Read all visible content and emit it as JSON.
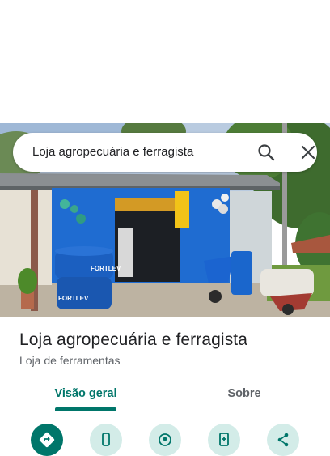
{
  "search": {
    "query": "Loja agropecuária e ferragista",
    "icons": [
      "search-icon",
      "close-icon"
    ]
  },
  "photo": {
    "signs": [
      "FORTLEV",
      "FORTLEV"
    ]
  },
  "place": {
    "title": "Loja agropecuária e ferragista",
    "category": "Loja de ferramentas"
  },
  "tabs": [
    {
      "label": "Visão geral",
      "selected": true
    },
    {
      "label": "Sobre",
      "selected": false
    }
  ],
  "actions": [
    {
      "icon": "directions-icon",
      "style": "primary"
    },
    {
      "icon": "phone-icon",
      "style": "light"
    },
    {
      "icon": "location-icon",
      "style": "light"
    },
    {
      "icon": "save-icon",
      "style": "light"
    },
    {
      "icon": "share-icon",
      "style": "light"
    }
  ],
  "colors": {
    "accent": "#00766a",
    "accent_light": "#d3ece8",
    "text_primary": "#202124",
    "text_secondary": "#5f6368"
  }
}
